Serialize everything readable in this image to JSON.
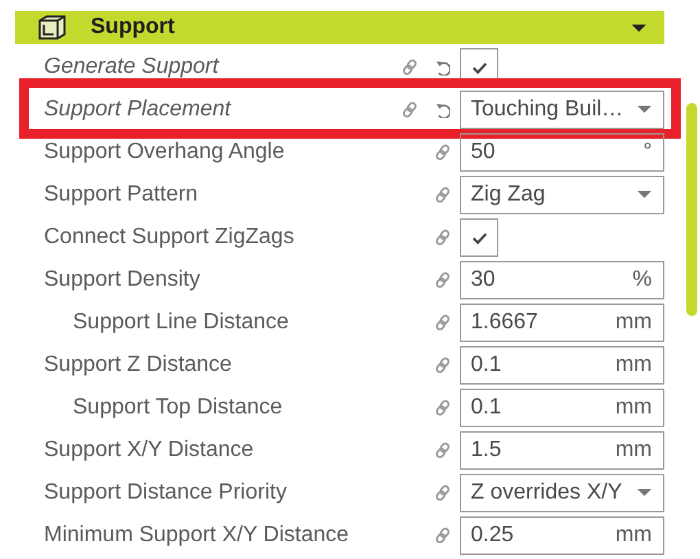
{
  "section": {
    "title": "Support",
    "expanded": true
  },
  "settings": [
    {
      "label": "Generate Support",
      "kind": "checkbox",
      "checked": true,
      "modified": true,
      "indented": false
    },
    {
      "label": "Support Placement",
      "kind": "dropdown",
      "value": "Touching Buil…",
      "modified": true,
      "indented": false,
      "highlighted": true
    },
    {
      "label": "Support Overhang Angle",
      "kind": "number",
      "value": "50",
      "unit": "°",
      "modified": false,
      "indented": false
    },
    {
      "label": "Support Pattern",
      "kind": "dropdown",
      "value": "Zig Zag",
      "modified": false,
      "indented": false
    },
    {
      "label": "Connect Support ZigZags",
      "kind": "checkbox",
      "checked": true,
      "modified": false,
      "indented": false
    },
    {
      "label": "Support Density",
      "kind": "number",
      "value": "30",
      "unit": "%",
      "modified": false,
      "indented": false
    },
    {
      "label": "Support Line Distance",
      "kind": "number",
      "value": "1.6667",
      "unit": "mm",
      "modified": false,
      "indented": true
    },
    {
      "label": "Support Z Distance",
      "kind": "number",
      "value": "0.1",
      "unit": "mm",
      "modified": false,
      "indented": false
    },
    {
      "label": "Support Top Distance",
      "kind": "number",
      "value": "0.1",
      "unit": "mm",
      "modified": false,
      "indented": true
    },
    {
      "label": "Support X/Y Distance",
      "kind": "number",
      "value": "1.5",
      "unit": "mm",
      "modified": false,
      "indented": false
    },
    {
      "label": "Support Distance Priority",
      "kind": "dropdown",
      "value": "Z overrides X/Y",
      "modified": false,
      "indented": false
    },
    {
      "label": "Minimum Support X/Y Distance",
      "kind": "number",
      "value": "0.25",
      "unit": "mm",
      "modified": false,
      "indented": false
    }
  ]
}
